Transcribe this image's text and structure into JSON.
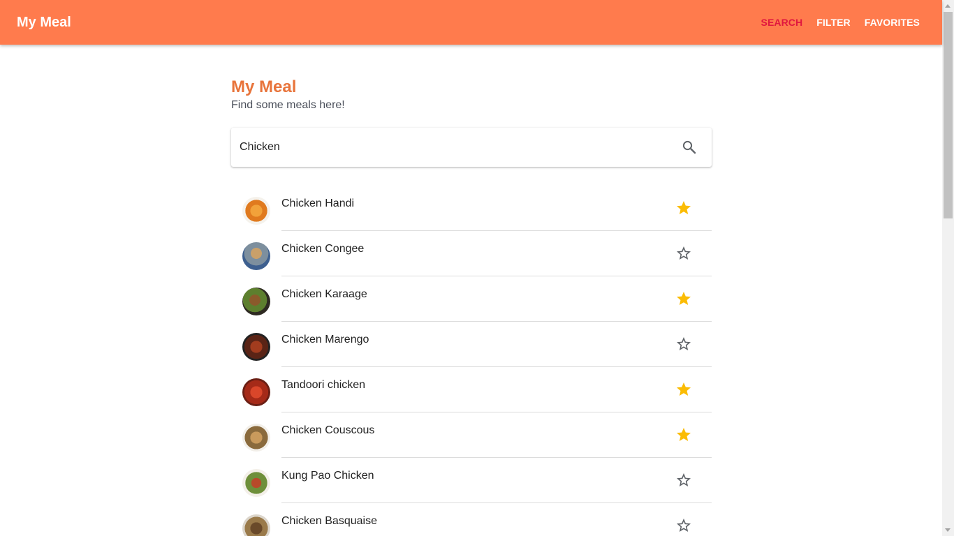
{
  "appbar": {
    "title": "My Meal",
    "nav": [
      "SEARCH",
      "FILTER",
      "FAVORITES"
    ]
  },
  "main": {
    "title": "My Meal",
    "subtitle": "Find some meals here!"
  },
  "search": {
    "value": "Chicken"
  },
  "meals": [
    {
      "name": "Chicken Handi",
      "favorite": true
    },
    {
      "name": "Chicken Congee",
      "favorite": false
    },
    {
      "name": "Chicken Karaage",
      "favorite": true
    },
    {
      "name": "Chicken Marengo",
      "favorite": false
    },
    {
      "name": "Tandoori chicken",
      "favorite": true
    },
    {
      "name": "Chicken Couscous",
      "favorite": true
    },
    {
      "name": "Kung Pao Chicken",
      "favorite": false
    },
    {
      "name": "Chicken Basquaise",
      "favorite": false
    }
  ],
  "colors": {
    "appbar": "#ff7b4d",
    "nav_active": "#e0173f",
    "title": "#e8743b",
    "star_filled": "#fbbc04",
    "star_outline": "#5f6368"
  },
  "icons": {
    "search": "search-icon",
    "favorite_on": "star-filled-icon",
    "favorite_off": "star-outline-icon"
  }
}
